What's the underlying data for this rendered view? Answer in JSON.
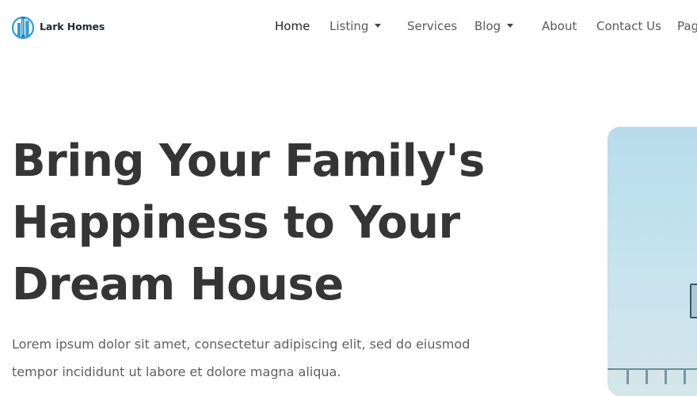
{
  "brand": {
    "name": "Lark Homes",
    "logo_icon": "building-logo-icon"
  },
  "colors": {
    "accent": "#2a9fd8",
    "text_dark": "#353535",
    "text_muted": "#5f5f5f"
  },
  "nav": {
    "items": [
      {
        "label": "Home",
        "active": true
      },
      {
        "label": "Listing",
        "dropdown": true
      },
      {
        "label": "Services"
      },
      {
        "label": "Blog",
        "dropdown": true
      },
      {
        "label": "About"
      },
      {
        "label": "Contact Us"
      },
      {
        "label": "Pag"
      }
    ]
  },
  "hero": {
    "headline_lines": [
      "Bring Your Family's",
      "Happiness to Your",
      "Dream House"
    ],
    "description": "Lorem ipsum dolor sit amet, consectetur adipiscing elit, sed do eiusmod tempor incididunt ut labore et dolore magna aliqua."
  }
}
